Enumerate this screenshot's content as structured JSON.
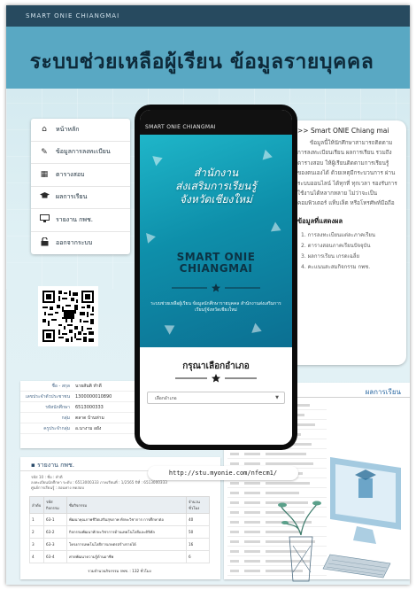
{
  "topbar": {
    "text": "SMART ONIE CHIANGMAI"
  },
  "main_title": "ระบบช่วยเหลือผู้เรียน ข้อมูลรายบุคคล",
  "menu": {
    "items": [
      {
        "label": "หน้าหลัก",
        "icon": "home-icon"
      },
      {
        "label": "ข้อมูลการลงทะเบียน",
        "icon": "edit-icon"
      },
      {
        "label": "ตารางสอบ",
        "icon": "calendar-icon"
      },
      {
        "label": "ผลการเรียน",
        "icon": "graduation-cap-icon"
      },
      {
        "label": "รายงาน กพช.",
        "icon": "monitor-icon"
      },
      {
        "label": "ออกจากระบบ",
        "icon": "unlock-icon"
      }
    ]
  },
  "phone": {
    "header": "SMART ONIE CHIANGMAI",
    "banner_sub_1": "สำนักงาน",
    "banner_sub_2": "ส่งเสริมการเรียนรู้",
    "banner_sub_3": "จังหวัดเชียงใหม่",
    "brand_1": "SMART ONIE",
    "brand_2": "CHIANGMAI",
    "banner_desc": "ระบบช่วยเหลือผู้เรียน ข้อมูลนักศึกษารายบุคคล สำนักงานส่งเสริมการเรียนรู้จังหวัดเชียงใหม่",
    "select_title": "กรุณาเลือกอำเภอ",
    "select_value": "เลือกอำเภอ"
  },
  "info_card": {
    "title": ">> Smart ONIE Chiang mai",
    "body": "ข้อมูลนี้ให้นักศึกษาสามารถติดตามการลงทะเบียนเรียน ผลการเรียน รวมถึงตารางสอบ ให้ผู้เรียนติดตามการเรียนรู้ของตนเองได้ ด้วยเหตุมีกระบวนการ ผ่านระบบออนไลน์ ได้ทุกที่ ทุกเวลา รองรับการใช้งานได้หลากหลาย ไม่ว่าจะเป็นคอมพิวเตอร์ แท็บเล็ต หรือโทรศัพท์มือถือ",
    "subtitle": "ข้อมูลที่แสดงผล",
    "list": [
      "1.  การลงทะเบียนแต่ละภาคเรียน",
      "2.  ตารางสอบภาคเรียนปัจจุบัน",
      "3.  ผลการเรียน เกรดเฉลี่ย",
      "4.  คะแนนสะสมกิจกรรม กพช."
    ]
  },
  "profile": {
    "rows": [
      {
        "label": "ชื่อ - สกุล",
        "value": "นายสันติ ทำดี"
      },
      {
        "label": "เลขประจำตัวประชาชน",
        "value": "1300000010890"
      },
      {
        "label": "รหัสนักศึกษา",
        "value": "6513000333"
      },
      {
        "label": "กลุ่ม",
        "value": "ตลาด บ้านท่าม"
      },
      {
        "label": "ครูประจำกลุ่ม",
        "value": "อ.นางาม อยัง"
      }
    ]
  },
  "report": {
    "title": "รายงาน กพช.",
    "note_1": "รหัส 10 : ชื่อ : ทำดี",
    "note_2": "ลงทะเบียนนักศึกษา ระดับ : 6513000333 ภาคเรียนที่ : 1/2565 ปีที่ : 6513000333",
    "note_3": "ศูนย์การเรียนรู้ : สอนทาง ทดสอบ",
    "headers": [
      "ลำดับ",
      "รหัสกิจกรรม",
      "ชื่อกิจกรรม",
      "จำนวนชั่วโมง"
    ],
    "rows": [
      [
        "1",
        "63-1",
        "พัฒนาคุณภาพชีวิตเสริมสุขภาพ ทักษะวิชาการ การศึกษาต่อ",
        "40"
      ],
      [
        "2",
        "63-2",
        "กิจกรรมพัฒนาทักษะวิชาการด้านเทคโนโลยีและดิจิทัล",
        "50"
      ],
      [
        "3",
        "63-3",
        "โครงการเทคโนโลยีการเกษตรสร้างรายได้",
        "16"
      ],
      [
        "4",
        "63-4",
        "ค่ายพัฒนาความรู้ด้านอาชีพ",
        "6"
      ]
    ],
    "total": "รวมจำนวนกิจกรรม กพช. : 132 ชั่วโมง"
  },
  "results": {
    "title": "ผลการเรียน"
  },
  "url": "http://stu.myonie.com/nfecm1/"
}
